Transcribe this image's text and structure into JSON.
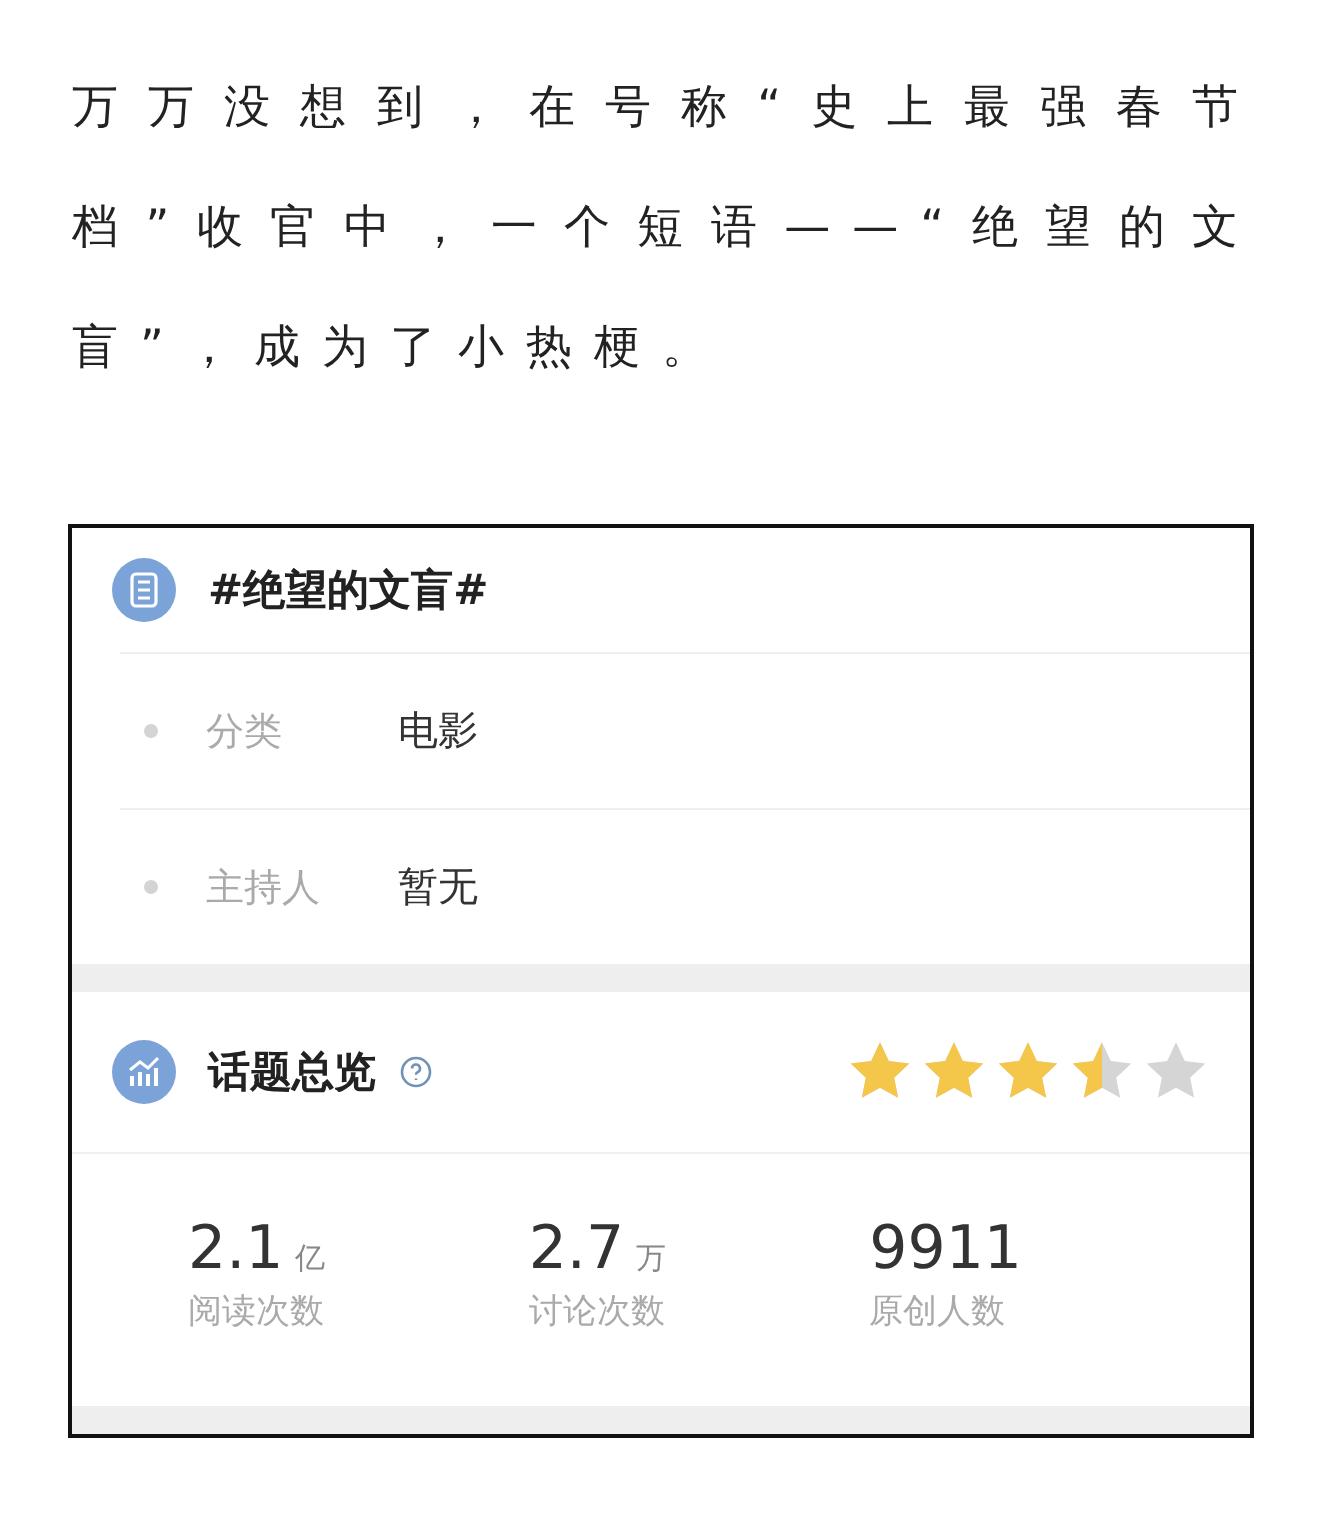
{
  "article": {
    "paragraph": "万万没想到，在号称“史上最强春节档”收官中，一个短语——“绝望的文盲”，成为了小热梗。"
  },
  "topic_card": {
    "title": "#绝望的文盲#",
    "details": [
      {
        "label": "分类",
        "value": "电影"
      },
      {
        "label": "主持人",
        "value": "暂无"
      }
    ],
    "overview": {
      "title": "话题总览",
      "stars": 3.5,
      "stats": [
        {
          "number": "2.1",
          "unit": "亿",
          "label": "阅读次数"
        },
        {
          "number": "2.7",
          "unit": "万",
          "label": "讨论次数"
        },
        {
          "number": "9911",
          "label": "原创人数"
        }
      ]
    }
  }
}
